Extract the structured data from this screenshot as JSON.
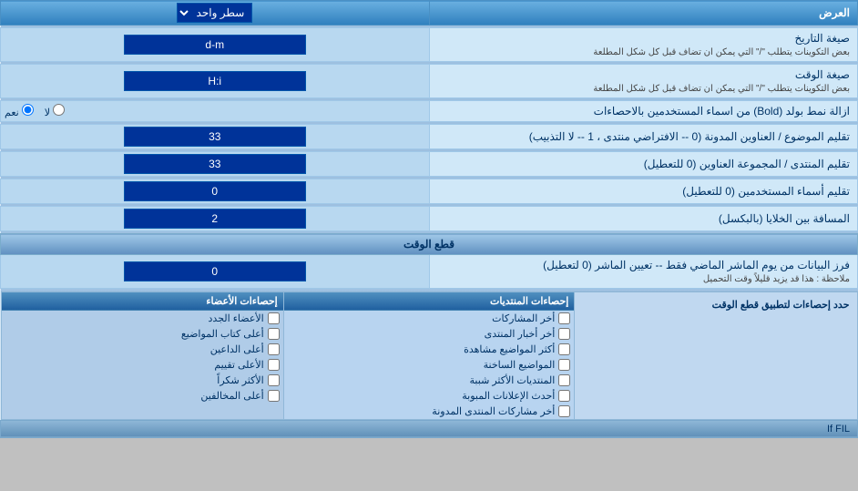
{
  "title": "العرض",
  "rows": [
    {
      "id": "single-line",
      "label": "سطر واحد",
      "type": "select",
      "value": "سطر واحد",
      "right_label": "العرض"
    },
    {
      "id": "date-format",
      "right_label": "صيغة التاريخ",
      "right_sublabel": "بعض التكوينات يتطلب \"/\" التي يمكن ان تضاف قبل كل شكل المطلعة",
      "type": "input",
      "value": "d-m"
    },
    {
      "id": "time-format",
      "right_label": "صيغة الوقت",
      "right_sublabel": "بعض التكوينات يتطلب \"/\" التي يمكن ان تضاف قبل كل شكل المطلعة",
      "type": "input",
      "value": "H:i"
    },
    {
      "id": "bold-remove",
      "right_label": "ازالة نمط بولد (Bold) من اسماء المستخدمين بالاحصاءات",
      "type": "radio",
      "options": [
        "نعم",
        "لا"
      ],
      "selected": "نعم"
    },
    {
      "id": "forum-order",
      "right_label": "تقليم الموضوع / العناوين المدونة (0 -- الافتراضي منتدى ، 1 -- لا التذبيب)",
      "type": "input",
      "value": "33"
    },
    {
      "id": "forum-group",
      "right_label": "تقليم المنتدى / المجموعة العناوين (0 للتعطيل)",
      "type": "input",
      "value": "33"
    },
    {
      "id": "user-names",
      "right_label": "تقليم أسماء المستخدمين (0 للتعطيل)",
      "type": "input",
      "value": "0"
    },
    {
      "id": "cell-gap",
      "right_label": "المسافة بين الخلايا (بالبكسل)",
      "type": "input",
      "value": "2"
    }
  ],
  "time_cut_section": {
    "title": "قطع الوقت",
    "label": "فرز البيانات من يوم الماشر الماضي فقط -- تعيين الماشر (0 لتعطيل)",
    "sublabel": "ملاحظة : هذا قد يزيد قليلاً وقت التحميل",
    "value": "0",
    "stats_label": "حدد إحصاءات لتطبيق قطع الوقت"
  },
  "stats_posts": {
    "header": "إحصاءات المنتديات",
    "items": [
      "أخر المشاركات",
      "أخر أخبار المنتدى",
      "أكثر المواضيع مشاهدة",
      "المواضيع الساخنة",
      "المنتديات الأكثر شببة",
      "أحدث الإعلانات المبوبة",
      "أخر مشاركات المنتدى المدونة"
    ]
  },
  "stats_members": {
    "header": "إحصاءات الأعضاء",
    "items": [
      "الأعضاء الجدد",
      "أعلى كتاب المواضيع",
      "أعلى الداعين",
      "الأعلى تقييم",
      "الأكثر شكراً",
      "أعلى المخالفين"
    ]
  },
  "if_fil": "If FIL"
}
